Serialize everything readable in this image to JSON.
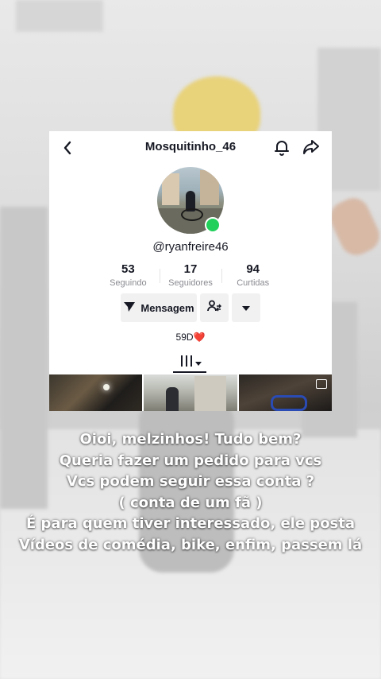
{
  "header": {
    "title": "Mosquitinho_46",
    "back_icon": "chevron-left-icon",
    "notification_icon": "bell-icon",
    "share_icon": "share-arrow-icon"
  },
  "profile": {
    "username": "@ryanfreire46",
    "online_color": "#20d05a",
    "stats": [
      {
        "value": "53",
        "label": "Seguindo"
      },
      {
        "value": "17",
        "label": "Seguidores"
      },
      {
        "value": "94",
        "label": "Curtidas"
      }
    ],
    "buttons": {
      "message_label": "Mensagem",
      "message_icon": "send-icon",
      "follow_icon": "user-swap-icon",
      "more_icon": "caret-down-icon"
    },
    "bio": "59D❤️"
  },
  "tabs": {
    "active_icon": "grid-bars-icon"
  },
  "caption_lines": [
    "Oioi, melzinhos! Tudo bem?",
    "Queria fazer um pedido para vcs",
    "Vcs podem seguir essa conta ?",
    "( conta de um fã )",
    "É para quem tiver interessado, ele posta",
    "Vídeos de comédia, bike, enfim, passem lá"
  ]
}
